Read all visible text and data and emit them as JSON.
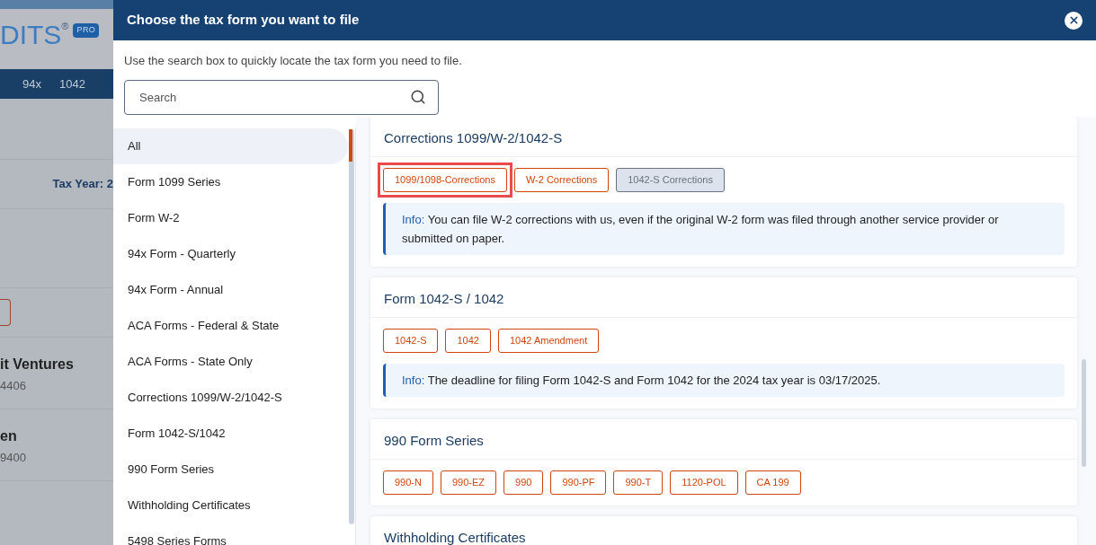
{
  "background_page": {
    "logo": "DITS",
    "registered_mark": "®",
    "badge": "PRO",
    "nav_items": [
      "94x",
      "1042"
    ],
    "tax_year": "Tax Year: 2",
    "companies": [
      {
        "name": "it Ventures",
        "number": "4406"
      },
      {
        "name": "en",
        "number": "9400"
      }
    ]
  },
  "dialog": {
    "title": "Choose the tax form you want to file",
    "description": "Use the search box to quickly locate the tax form you need to file.",
    "search": {
      "placeholder": "Search"
    },
    "categories": [
      {
        "label": "All",
        "selected": true
      },
      {
        "label": "Form 1099 Series",
        "selected": false
      },
      {
        "label": "Form W-2",
        "selected": false
      },
      {
        "label": "94x Form - Quarterly",
        "selected": false
      },
      {
        "label": "94x Form - Annual",
        "selected": false
      },
      {
        "label": "ACA Forms - Federal & State",
        "selected": false
      },
      {
        "label": "ACA Forms - State Only",
        "selected": false
      },
      {
        "label": "Corrections 1099/W-2/1042-S",
        "selected": false
      },
      {
        "label": "Form 1042-S/1042",
        "selected": false
      },
      {
        "label": "990 Form Series",
        "selected": false
      },
      {
        "label": "Withholding Certificates",
        "selected": false
      },
      {
        "label": "5498 Series Forms",
        "selected": false
      }
    ],
    "sections": [
      {
        "title": "Corrections 1099/W-2/1042-S",
        "forms": [
          {
            "label": "1099/1098-Corrections",
            "disabled": false,
            "highlighted": true
          },
          {
            "label": "W-2 Corrections",
            "disabled": false,
            "highlighted": false
          },
          {
            "label": "1042-S Corrections",
            "disabled": true,
            "highlighted": false
          }
        ],
        "info": {
          "label": "Info:",
          "text": "You can file W-2 corrections with us, even if the original W-2 form was filed through another service provider or submitted on paper."
        }
      },
      {
        "title": "Form 1042-S / 1042",
        "forms": [
          {
            "label": "1042-S",
            "disabled": false,
            "highlighted": false
          },
          {
            "label": "1042",
            "disabled": false,
            "highlighted": false
          },
          {
            "label": "1042 Amendment",
            "disabled": false,
            "highlighted": false
          }
        ],
        "info": {
          "label": "Info:",
          "text": "The deadline for filing Form 1042-S and Form 1042 for the 2024 tax year is 03/17/2025."
        }
      },
      {
        "title": "990 Form Series",
        "forms": [
          {
            "label": "990-N",
            "disabled": false,
            "highlighted": false
          },
          {
            "label": "990-EZ",
            "disabled": false,
            "highlighted": false
          },
          {
            "label": "990",
            "disabled": false,
            "highlighted": false
          },
          {
            "label": "990-PF",
            "disabled": false,
            "highlighted": false
          },
          {
            "label": "990-T",
            "disabled": false,
            "highlighted": false
          },
          {
            "label": "1120-POL",
            "disabled": false,
            "highlighted": false
          },
          {
            "label": "CA 199",
            "disabled": false,
            "highlighted": false
          }
        ]
      },
      {
        "title": "Withholding Certificates"
      }
    ]
  }
}
